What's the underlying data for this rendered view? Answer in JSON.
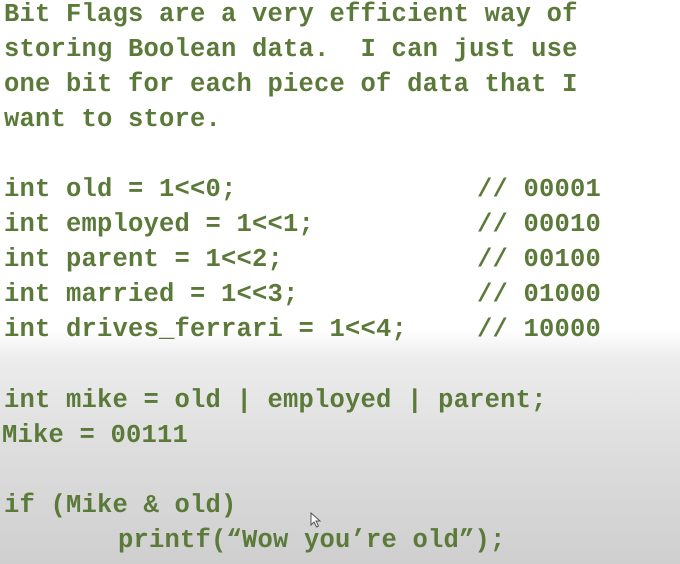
{
  "intro": {
    "lines": [
      "Bit Flags are a very efficient way of",
      "storing Boolean data.  I can just use",
      "one bit for each piece of data that I",
      "want to store."
    ]
  },
  "flags": [
    {
      "code": "int old = 1<<0;",
      "comment": "// 00001"
    },
    {
      "code": "int employed = 1<<1;",
      "comment": "// 00010"
    },
    {
      "code": "int parent = 1<<2;",
      "comment": "// 00100"
    },
    {
      "code": "int married = 1<<3;",
      "comment": "// 01000"
    },
    {
      "code": "int drives_ferrari = 1<<4;",
      "comment": "// 10000"
    }
  ],
  "combine": {
    "declaration": "int mike = old | employed | parent;",
    "result": "Mike = 00111"
  },
  "condition": {
    "if_line": "if (Mike & old)",
    "body_line": "printf(“Wow you’re old”);"
  },
  "colors": {
    "text": "#5b7a3a",
    "background_top": "#ffffff",
    "background_bottom": "#cfcfcf"
  }
}
